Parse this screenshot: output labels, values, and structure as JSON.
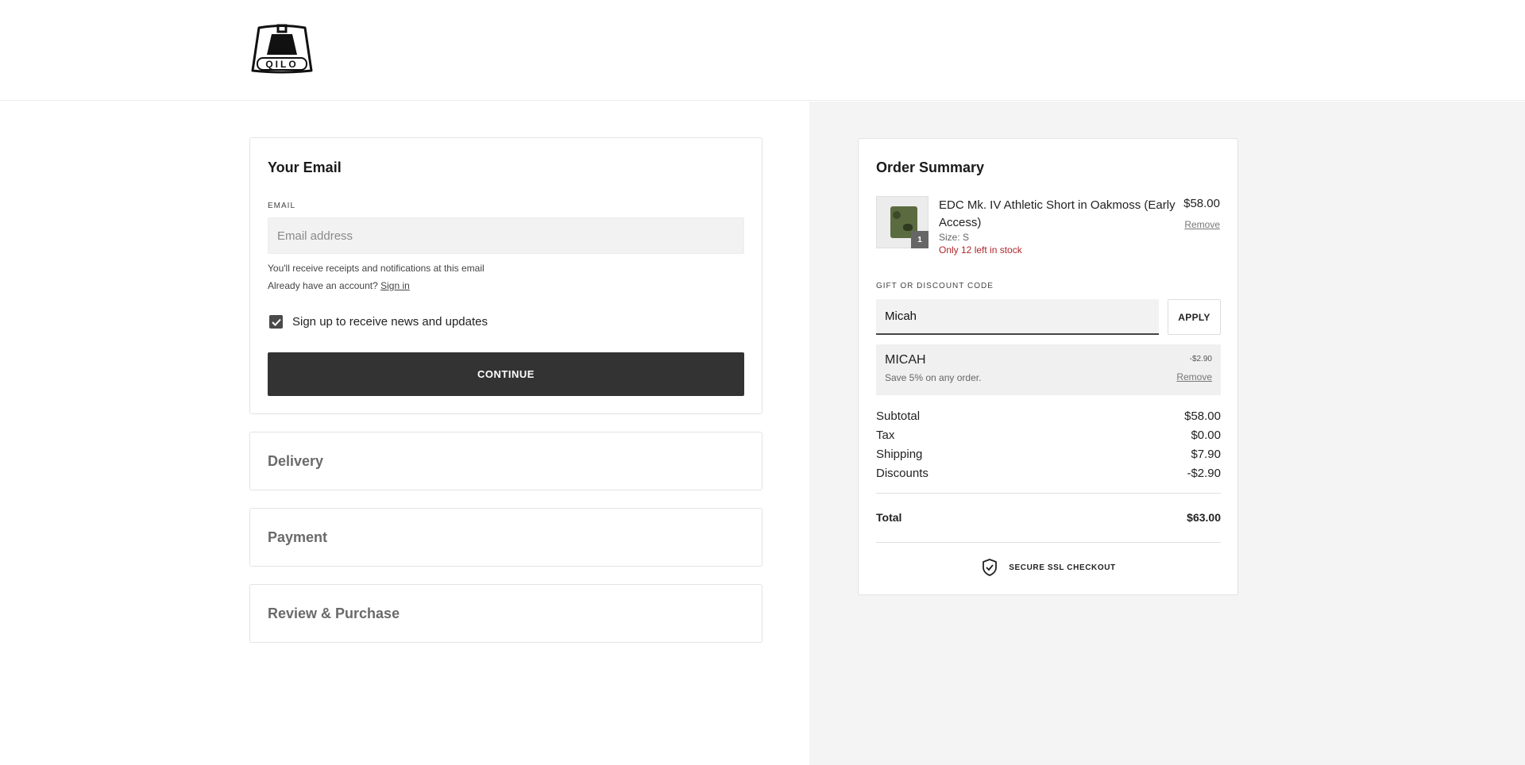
{
  "brand": {
    "logo_text": "QILO"
  },
  "email_section": {
    "title": "Your Email",
    "field_label": "EMAIL",
    "placeholder": "Email address",
    "value": "",
    "helper": "You'll receive receipts and notifications at this email",
    "account_prompt": "Already have an account?",
    "sign_in_label": "Sign in",
    "newsletter_label": "Sign up to receive news and updates",
    "newsletter_checked": true,
    "continue_label": "CONTINUE"
  },
  "steps": {
    "delivery": "Delivery",
    "payment": "Payment",
    "review": "Review & Purchase"
  },
  "order_summary": {
    "title": "Order Summary",
    "item": {
      "name": "EDC Mk. IV Athletic Short in Oakmoss (Early Access)",
      "price": "$58.00",
      "remove_label": "Remove",
      "size": "Size: S",
      "stock": "Only 12 left in stock",
      "quantity": "1"
    },
    "code_label": "GIFT OR DISCOUNT CODE",
    "code_value": "Micah",
    "apply_label": "APPLY",
    "discount": {
      "code": "MICAH",
      "description": "Save 5% on any order.",
      "amount": "-$2.90",
      "remove_label": "Remove"
    },
    "subtotal_label": "Subtotal",
    "subtotal": "$58.00",
    "tax_label": "Tax",
    "tax": "$0.00",
    "shipping_label": "Shipping",
    "shipping": "$7.90",
    "discounts_label": "Discounts",
    "discounts": "-$2.90",
    "total_label": "Total",
    "total": "$63.00",
    "secure_label": "SECURE SSL CHECKOUT"
  },
  "colors": {
    "primary_button": "#333333",
    "stock_warning": "#b0252a",
    "summary_background": "#f4f4f4"
  }
}
